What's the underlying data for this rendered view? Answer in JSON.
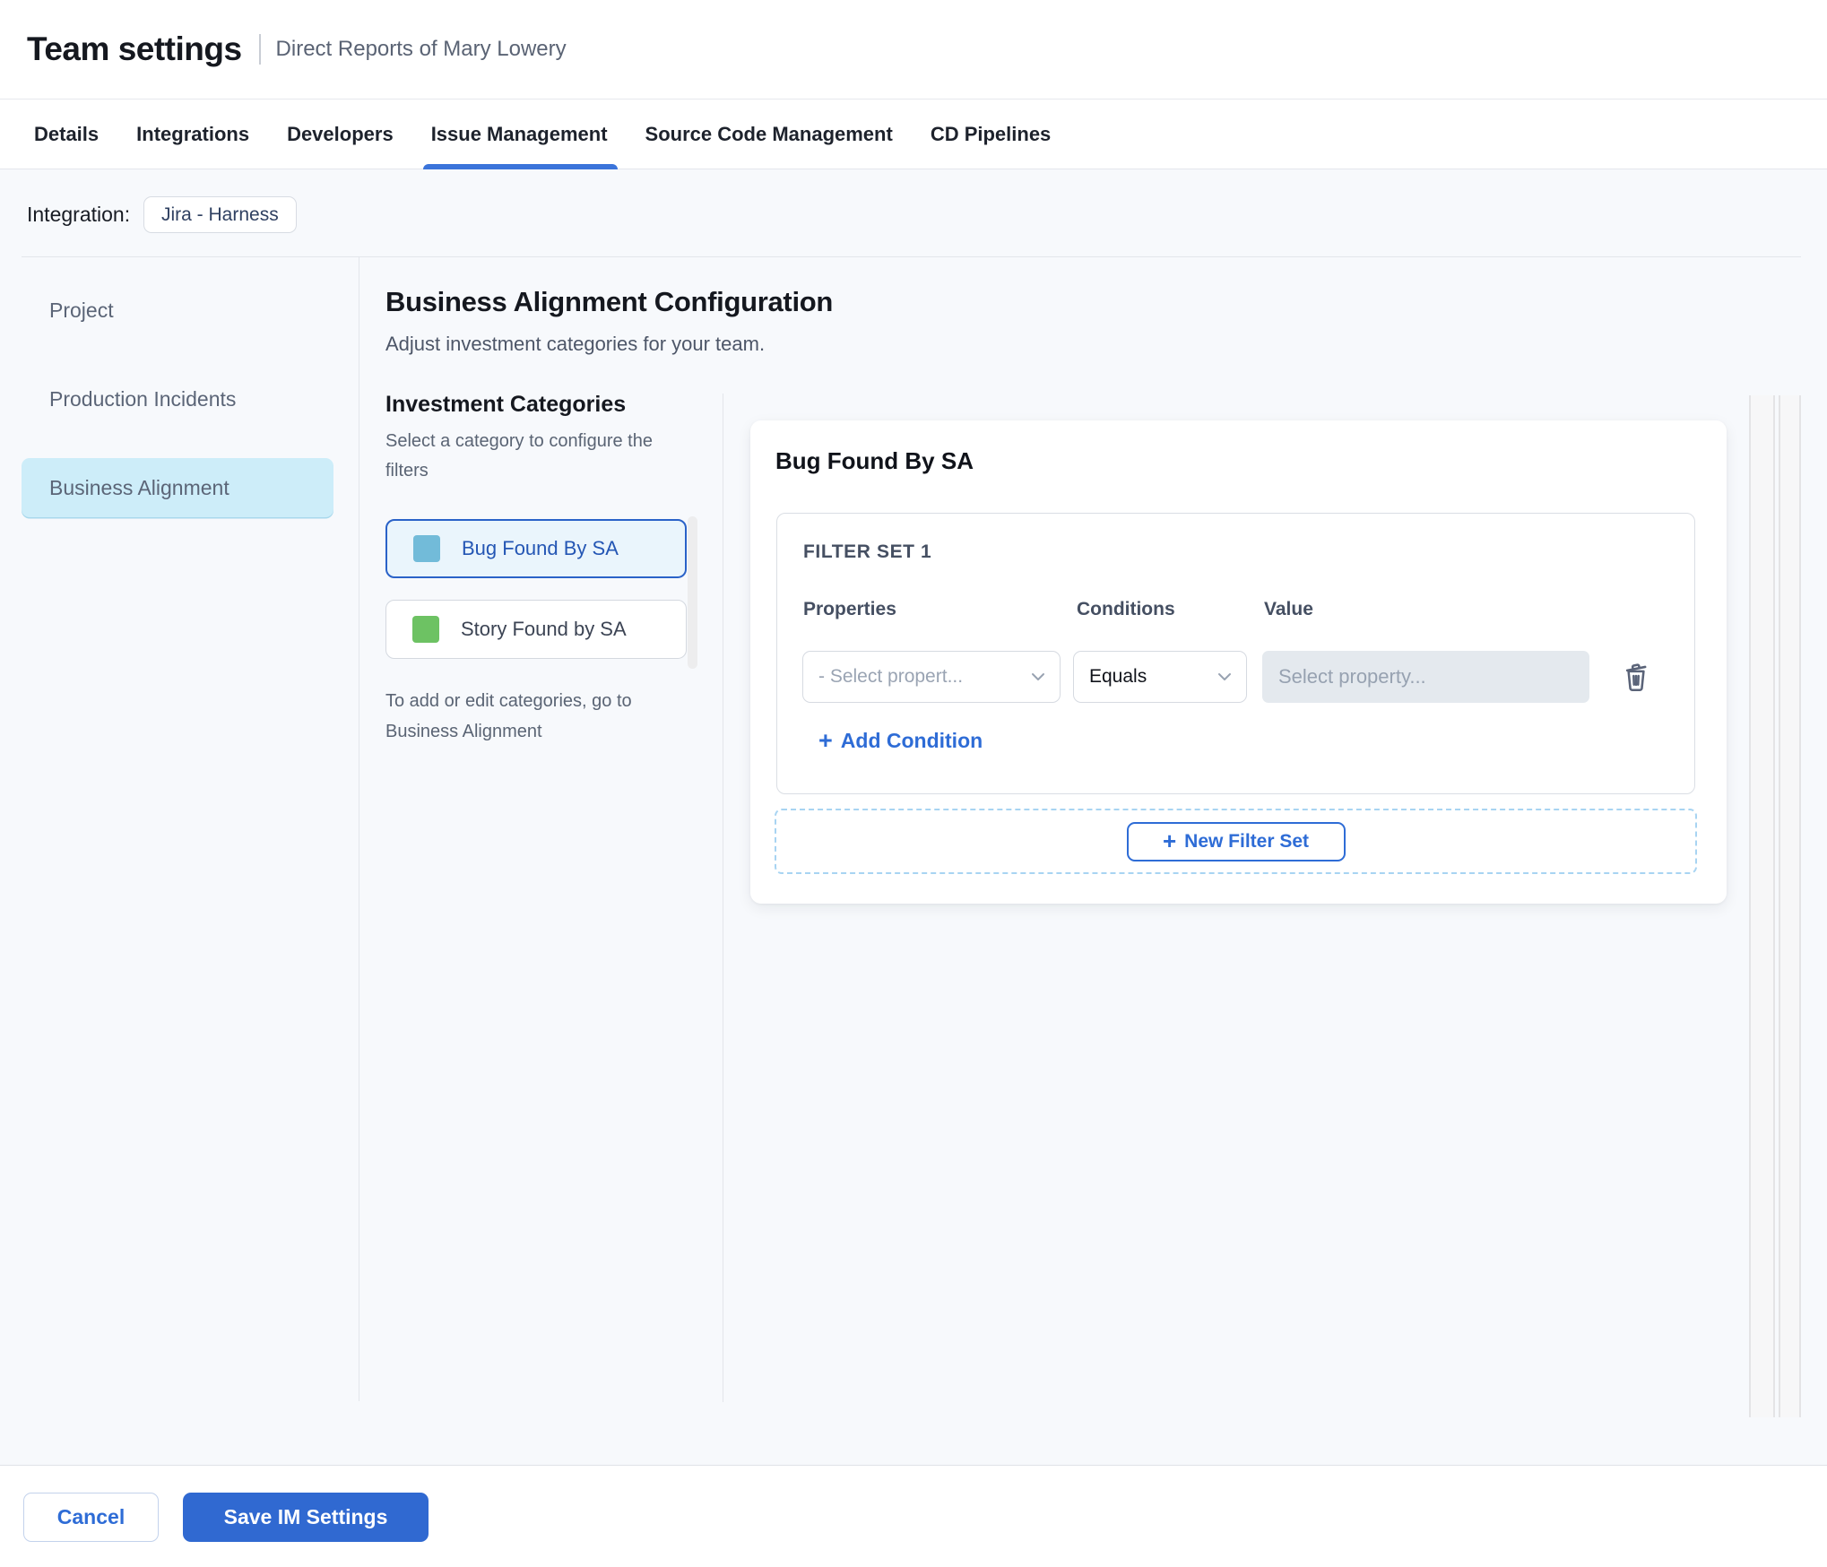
{
  "header": {
    "title": "Team settings",
    "subtitle": "Direct Reports of Mary Lowery"
  },
  "tabs": {
    "items": [
      {
        "label": "Details"
      },
      {
        "label": "Integrations"
      },
      {
        "label": "Developers"
      },
      {
        "label": "Issue Management",
        "active": true
      },
      {
        "label": "Source Code Management"
      },
      {
        "label": "CD Pipelines"
      }
    ]
  },
  "integration": {
    "label": "Integration:",
    "value": "Jira - Harness"
  },
  "sidebar": {
    "items": [
      {
        "label": "Project"
      },
      {
        "label": "Production Incidents"
      },
      {
        "label": "Business Alignment",
        "selected": true
      }
    ]
  },
  "main": {
    "title": "Business Alignment Configuration",
    "subtitle": "Adjust investment categories for your team.",
    "categories": {
      "heading": "Investment Categories",
      "hint": "Select a category to configure the filters",
      "items": [
        {
          "label": "Bug Found By SA",
          "swatch_color": "#72bbd9",
          "selected": true
        },
        {
          "label": "Story Found by SA",
          "swatch_color": "#6dc263",
          "selected": false
        }
      ],
      "footnote": "To add or edit categories, go to Business Alignment"
    },
    "panel": {
      "title": "Bug Found By SA",
      "filter_set": {
        "title": "FILTER SET 1",
        "columns": {
          "properties": "Properties",
          "conditions": "Conditions",
          "value": "Value"
        },
        "row": {
          "property_placeholder": "- Select propert...",
          "condition_value": "Equals",
          "value_placeholder": "Select property..."
        },
        "add_condition_label": "Add Condition"
      },
      "new_filter_set_label": "New Filter Set"
    }
  },
  "footer": {
    "cancel_label": "Cancel",
    "save_label": "Save IM Settings"
  },
  "icons": {
    "plus": "+"
  },
  "colors": {
    "accent_blue": "#2e6cd6",
    "tab_underline": "#3b74da",
    "selected_sidebar_bg": "#cdedf9",
    "save_button_bg": "#3069d1"
  }
}
